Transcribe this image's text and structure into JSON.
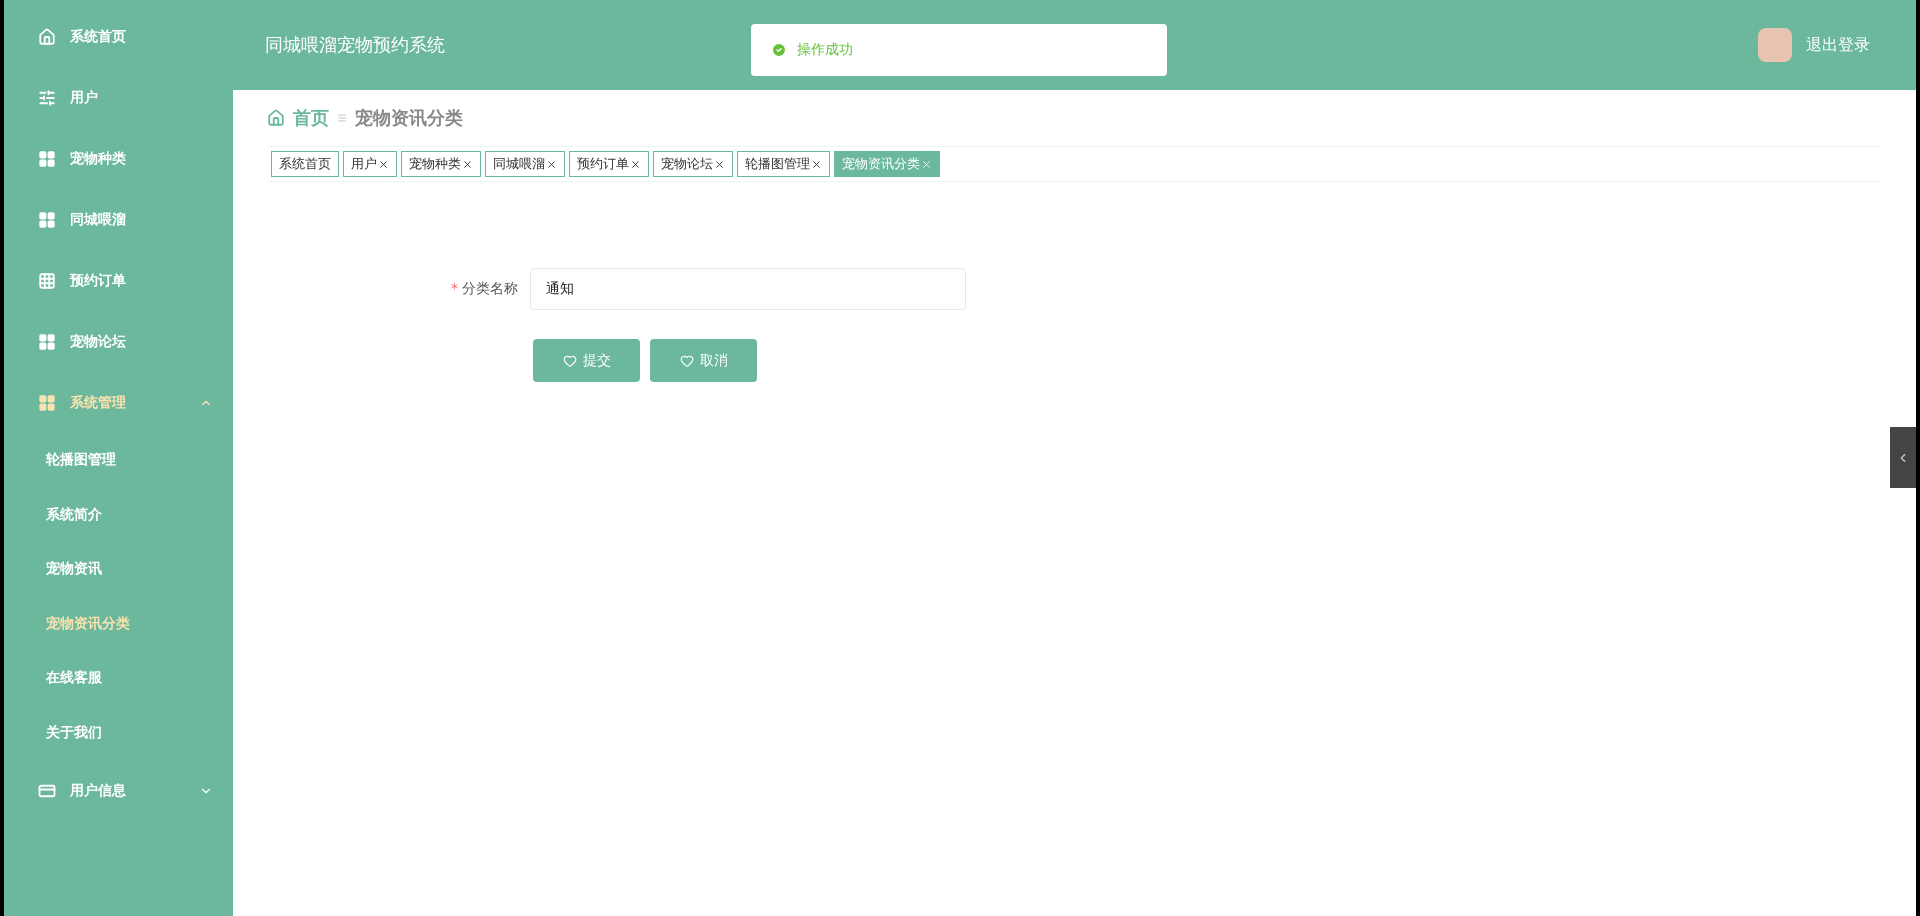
{
  "sidebar": {
    "items": [
      {
        "label": "系统首页",
        "kind": "home",
        "selected": false
      },
      {
        "label": "用户",
        "kind": "sliders",
        "selected": false
      },
      {
        "label": "宠物种类",
        "kind": "grid",
        "selected": false
      },
      {
        "label": "同城喂溜",
        "kind": "grid",
        "selected": false
      },
      {
        "label": "预约订单",
        "kind": "table",
        "selected": false
      },
      {
        "label": "宠物论坛",
        "kind": "grid",
        "selected": false
      },
      {
        "label": "系统管理",
        "kind": "grid",
        "selected": true,
        "expanded": true,
        "children": [
          {
            "label": "轮播图管理",
            "selected": false
          },
          {
            "label": "系统简介",
            "selected": false
          },
          {
            "label": "宠物资讯",
            "selected": false
          },
          {
            "label": "宠物资讯分类",
            "selected": true
          },
          {
            "label": "在线客服",
            "selected": false
          },
          {
            "label": "关于我们",
            "selected": false
          }
        ]
      },
      {
        "label": "用户信息",
        "kind": "card",
        "selected": false,
        "expanded": false
      }
    ]
  },
  "header": {
    "title": "同城喂溜宠物预约系统",
    "logout": "退出登录"
  },
  "toast": {
    "message": "操作成功"
  },
  "breadcrumb": [
    "首页",
    "宠物资讯分类"
  ],
  "tabs": [
    {
      "label": "系统首页",
      "closable": false,
      "selected": false
    },
    {
      "label": "用户",
      "closable": true,
      "selected": false
    },
    {
      "label": "宠物种类",
      "closable": true,
      "selected": false
    },
    {
      "label": "同城喂溜",
      "closable": true,
      "selected": false
    },
    {
      "label": "预约订单",
      "closable": true,
      "selected": false
    },
    {
      "label": "宠物论坛",
      "closable": true,
      "selected": false
    },
    {
      "label": "轮播图管理",
      "closable": true,
      "selected": false
    },
    {
      "label": "宠物资讯分类",
      "closable": true,
      "selected": true
    }
  ],
  "form": {
    "fields": [
      {
        "label": "分类名称",
        "required_mark": "*",
        "value": "通知"
      }
    ],
    "buttons": [
      "提交",
      "取消"
    ]
  }
}
